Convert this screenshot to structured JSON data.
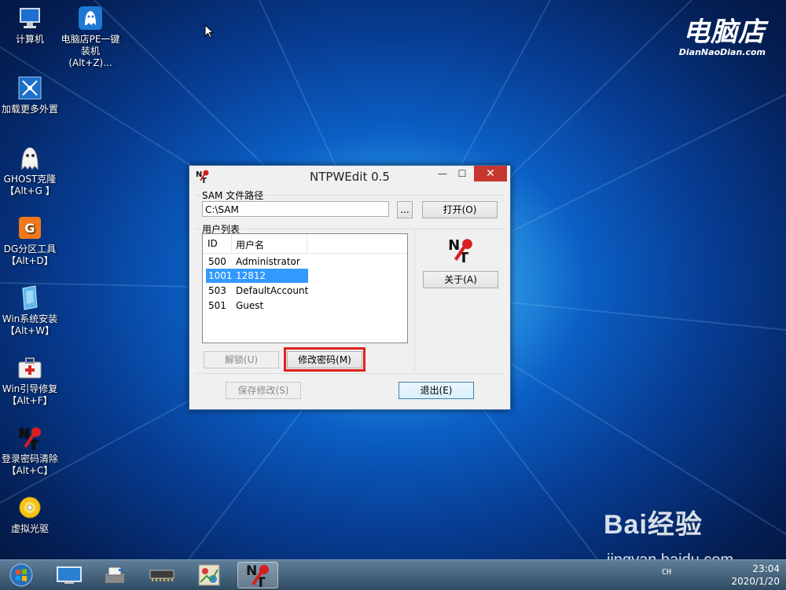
{
  "desktop": {
    "icons": [
      {
        "label": "计算机",
        "label2": "",
        "icon": "computer-icon"
      },
      {
        "label": "电脑店PE一键",
        "label2": "装机(Alt+Z)...",
        "icon": "ghost-installer-icon"
      },
      {
        "label": "加载更多外置",
        "label2": "",
        "icon": "load-more-icon"
      },
      {
        "label": "GHOST克隆",
        "label2": "【Alt+G 】",
        "icon": "ghost-icon"
      },
      {
        "label": "DG分区工具",
        "label2": "【Alt+D】",
        "icon": "diskgenius-icon"
      },
      {
        "label": "Win系统安装",
        "label2": "【Alt+W】",
        "icon": "win-install-icon"
      },
      {
        "label": "Win引导修复",
        "label2": "【Alt+F】",
        "icon": "boot-repair-icon"
      },
      {
        "label": "登录密码清除",
        "label2": "【Alt+C】",
        "icon": "password-clear-icon"
      },
      {
        "label": "虚拟光驱",
        "label2": "",
        "icon": "virtual-drive-icon"
      }
    ],
    "brand": {
      "name": "电脑店",
      "sub": "DianNaoDian.com"
    },
    "watermark": {
      "logo": "Bai经验",
      "url": "jingyan.baidu.com"
    }
  },
  "window": {
    "title": "NTPWEdit 0.5",
    "sam_group_label": "SAM 文件路径",
    "sam_path_value": "C:\\SAM",
    "browse_label": "...",
    "open_label": "打开(O)",
    "user_group_label": "用户列表",
    "columns": {
      "id": "ID",
      "name": "用户名"
    },
    "users": [
      {
        "id": "500",
        "name": "Administrator"
      },
      {
        "id": "1001",
        "name": "12812"
      },
      {
        "id": "503",
        "name": "DefaultAccount"
      },
      {
        "id": "501",
        "name": "Guest"
      }
    ],
    "about_label": "关于(A)",
    "unlock_label": "解锁(U)",
    "change_password_label": "修改密码(M)",
    "save_label": "保存修改(S)",
    "exit_label": "退出(E)",
    "close_glyph": "✕",
    "min_glyph": "—",
    "max_glyph": "☐"
  },
  "taskbar": {
    "ime": "CH",
    "time": "23:04",
    "date": "2020/1/20"
  },
  "colors": {
    "selection": "#3399ff",
    "highlight": "#e0221c",
    "close": "#c7372f"
  }
}
